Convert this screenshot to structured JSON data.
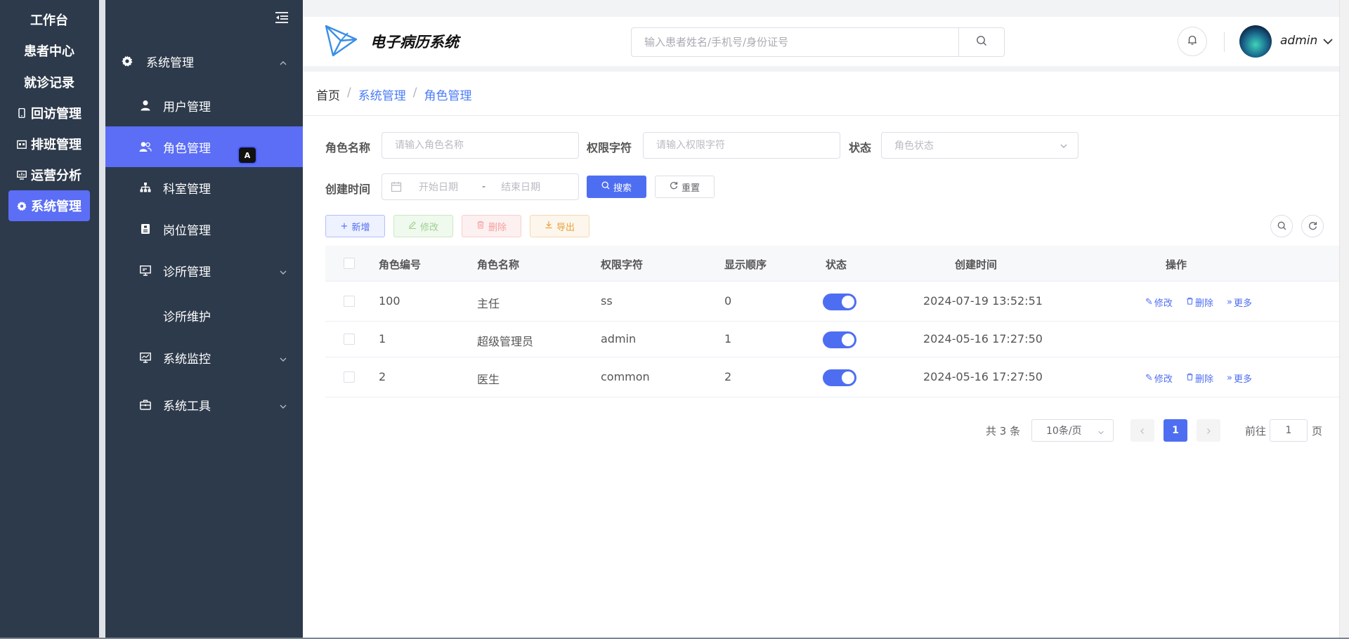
{
  "rail": {
    "items": [
      {
        "label": "工作台",
        "icon": "none"
      },
      {
        "label": "患者中心",
        "icon": "none"
      },
      {
        "label": "就诊记录",
        "icon": "none"
      },
      {
        "label": "回访管理",
        "icon": "phone-icon"
      },
      {
        "label": "排班管理",
        "icon": "calendar-icon"
      },
      {
        "label": "运营分析",
        "icon": "monitor-icon"
      },
      {
        "label": "系统管理",
        "icon": "gear-icon",
        "active": true
      }
    ]
  },
  "sidebar": {
    "group": {
      "label": "系统管理",
      "icon": "gear-icon"
    },
    "items": [
      {
        "label": "用户管理",
        "icon": "user-icon"
      },
      {
        "label": "角色管理",
        "icon": "users-icon",
        "active": true
      },
      {
        "label": "科室管理",
        "icon": "tree-icon"
      },
      {
        "label": "岗位管理",
        "icon": "badge-icon"
      },
      {
        "label": "诊所管理",
        "icon": "monitor-icon"
      },
      {
        "label": "诊所维护",
        "icon": "none"
      },
      {
        "label": "系统监控",
        "icon": "chart-icon"
      },
      {
        "label": "系统工具",
        "icon": "toolbox-icon"
      }
    ],
    "translate_badge": "A"
  },
  "header": {
    "app_title": "电子病历系统",
    "search_placeholder": "输入患者姓名/手机号/身份证号",
    "user_name": "admin"
  },
  "breadcrumb": {
    "home": "首页",
    "section": "系统管理",
    "current": "角色管理",
    "separator": "/"
  },
  "filters": {
    "role_name_label": "角色名称",
    "role_name_placeholder": "请输入角色名称",
    "perm_label": "权限字符",
    "perm_placeholder": "请输入权限字符",
    "status_label": "状态",
    "status_placeholder": "角色状态",
    "created_label": "创建时间",
    "start_placeholder": "开始日期",
    "range_sep": "-",
    "end_placeholder": "结束日期",
    "search_btn": "搜索",
    "reset_btn": "重置"
  },
  "toolbar": {
    "add": "新增",
    "edit": "修改",
    "delete": "删除",
    "export": "导出"
  },
  "table": {
    "headers": [
      "角色编号",
      "角色名称",
      "权限字符",
      "显示顺序",
      "状态",
      "创建时间",
      "操作"
    ],
    "rows": [
      {
        "id": "100",
        "name": "主任",
        "perm": "ss",
        "order": "0",
        "enabled": true,
        "created": "2024-07-19 13:52:51",
        "ops": [
          "修改",
          "删除",
          "更多"
        ]
      },
      {
        "id": "1",
        "name": "超级管理员",
        "perm": "admin",
        "order": "1",
        "enabled": true,
        "created": "2024-05-16 17:27:50",
        "ops": []
      },
      {
        "id": "2",
        "name": "医生",
        "perm": "common",
        "order": "2",
        "enabled": true,
        "created": "2024-05-16 17:27:50",
        "ops": [
          "修改",
          "删除",
          "更多"
        ]
      }
    ]
  },
  "pagination": {
    "total": "共 3 条",
    "page_size": "10条/页",
    "current": "1",
    "goto_label": "前往",
    "goto_value": "1",
    "page_suffix": "页"
  },
  "colors": {
    "sidebar_bg": "#2d3a4b",
    "accent": "#4e6ef2",
    "link": "#4a7cf7"
  }
}
